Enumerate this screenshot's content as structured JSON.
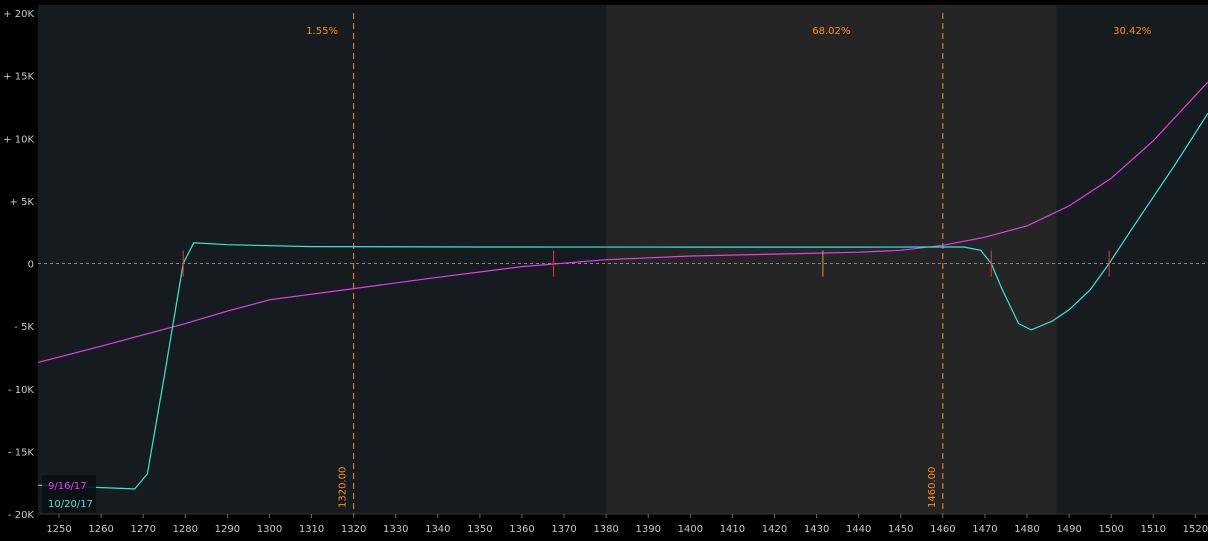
{
  "chart_data": {
    "type": "line",
    "xlim": [
      1245,
      1523
    ],
    "ylim": [
      -20000,
      20000
    ],
    "x_ticks": [
      1250,
      1260,
      1270,
      1280,
      1290,
      1300,
      1310,
      1320,
      1330,
      1340,
      1350,
      1360,
      1370,
      1380,
      1390,
      1400,
      1410,
      1420,
      1430,
      1440,
      1450,
      1460,
      1470,
      1480,
      1490,
      1500,
      1510,
      1520
    ],
    "x_tick_labels": [
      "1250",
      "1260",
      "1270",
      "1280",
      "1290",
      "1300",
      "1310",
      "1320",
      "1330",
      "1340",
      "1350",
      "1360",
      "1370",
      "1380",
      "1390",
      "1400",
      "1410",
      "1420",
      "1430",
      "1440",
      "1450",
      "1460",
      "1470",
      "1480",
      "1490",
      "1500",
      "1510",
      "1520"
    ],
    "y_ticks": [
      20000,
      15000,
      10000,
      5000,
      0,
      -5000,
      -10000,
      -15000,
      -20000
    ],
    "y_tick_labels": [
      "+ 20K",
      "+ 15K",
      "+ 10K",
      "+ 5K",
      "0",
      "- 5K",
      "- 10K",
      "- 15K",
      "- 20K"
    ],
    "zones": [
      {
        "from": 1245,
        "to": 1380,
        "label": "1.55%",
        "color": "#161b20"
      },
      {
        "from": 1380,
        "to": 1487,
        "label": "68.02%",
        "color": "#252525"
      },
      {
        "from": 1487,
        "to": 1523,
        "label": "30.42%",
        "color": "#161b20"
      }
    ],
    "vlines": [
      {
        "x": 1320,
        "label": "1320.00",
        "color": "#ff8a1a"
      },
      {
        "x": 1460,
        "label": "1460.00",
        "color": "#ff8a1a"
      }
    ],
    "zero_line_color": "#888888",
    "markers": [
      {
        "x": 1279.5,
        "color": "#ff3030"
      },
      {
        "x": 1367.5,
        "color": "#ff3030"
      },
      {
        "x": 1431.5,
        "color": "#c8a030"
      },
      {
        "x": 1471.5,
        "color": "#ff3030"
      },
      {
        "x": 1499.5,
        "color": "#ff3030"
      }
    ],
    "series": [
      {
        "name": "9/16/17",
        "color": "#e040e8",
        "x": [
          1245,
          1260,
          1280,
          1290,
          1300,
          1320,
          1340,
          1360,
          1380,
          1400,
          1420,
          1440,
          1450,
          1460,
          1470,
          1480,
          1490,
          1500,
          1510,
          1523
        ],
        "y": [
          -7900,
          -6600,
          -4800,
          -3800,
          -2900,
          -2000,
          -1100,
          -250,
          300,
          600,
          750,
          900,
          1050,
          1450,
          2100,
          3000,
          4600,
          6800,
          9800,
          14500
        ]
      },
      {
        "name": "10/20/17",
        "color": "#30e8e0",
        "x": [
          1245,
          1268,
          1271,
          1275,
          1279.5,
          1282,
          1290,
          1310,
          1350,
          1400,
          1440,
          1460,
          1465,
          1469,
          1471.5,
          1474,
          1478,
          1481,
          1486,
          1490,
          1495,
          1499.5,
          1505,
          1515,
          1523
        ],
        "y": [
          -17700,
          -18000,
          -16800,
          -9000,
          0,
          1650,
          1500,
          1350,
          1320,
          1310,
          1310,
          1320,
          1320,
          1050,
          0,
          -2000,
          -4800,
          -5300,
          -4600,
          -3700,
          -2100,
          0,
          2800,
          7800,
          12000
        ]
      }
    ]
  }
}
